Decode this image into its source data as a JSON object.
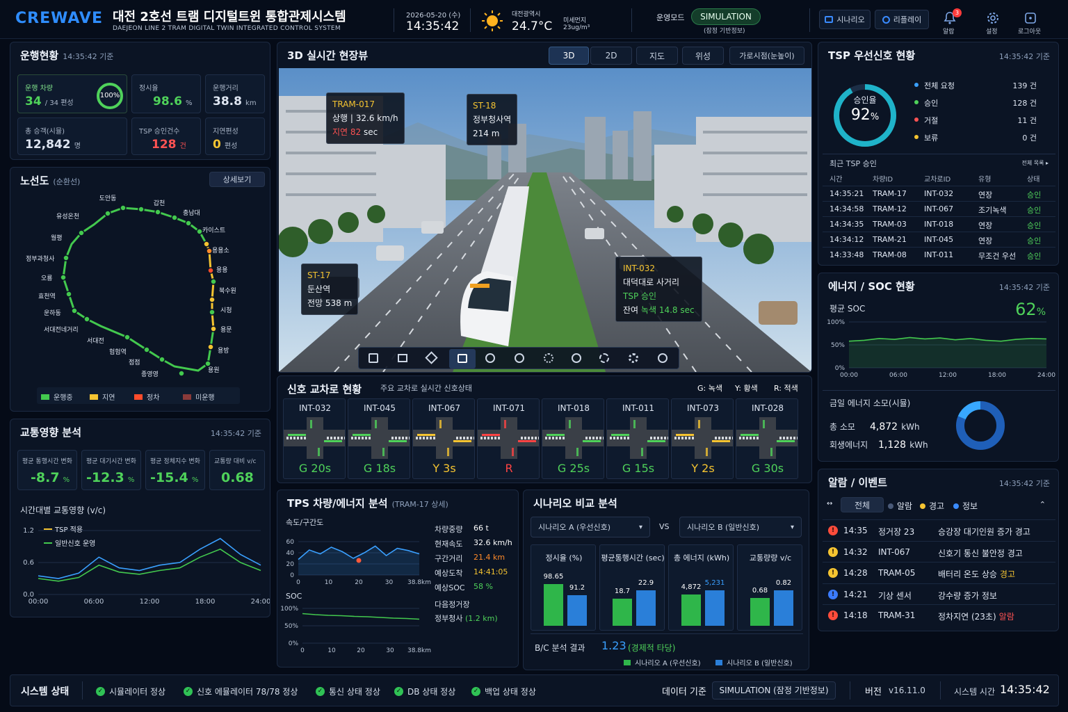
{
  "header": {
    "logo": "CREWAVE",
    "title": "대전 2호선 트램 디지털트윈 통합관제시스템",
    "subtitle": "DAEJEON LINE 2 TRAM DIGITAL TWIN INTEGRATED CONTROL SYSTEM",
    "date": "2026-05-20 (수)",
    "time": "14:35:42",
    "region": "대전광역시",
    "temp": "24.7°C",
    "dust_label": "미세먼지",
    "dust_value": "23ug/m³",
    "mode_label": "운영모드",
    "mode_value": "SIMULATION",
    "mode_sub": "(잠정 기반정보)",
    "btn_scenario": "시나리오",
    "btn_replay": "리플레이",
    "alarm_label": "알람",
    "alarm_count": "3",
    "settings_label": "설정",
    "logout_label": "로그아웃"
  },
  "ops": {
    "title": "운행현황",
    "ts": "14:35:42 기준",
    "c1_label": "운행 차량",
    "c1_value": "34",
    "c1_unit": "/ 34 편성",
    "c1_pct": "100%",
    "c2_label": "정시율",
    "c2_value": "98.6",
    "c2_unit": "%",
    "c3_label": "운행거리",
    "c3_value": "38.8",
    "c3_unit": "km",
    "c4_label": "총 승객(시뮬)",
    "c4_value": "12,842",
    "c4_unit": "명",
    "c5_label": "TSP 승인건수",
    "c5_value": "128",
    "c5_unit": "건",
    "c6_label": "지연편성",
    "c6_value": "0",
    "c6_unit": "편성"
  },
  "route": {
    "title": "노선도",
    "title_sub": "(순환선)",
    "detail_btn": "상세보기",
    "stations": [
      {
        "name": "도안동"
      },
      {
        "name": "갑천"
      },
      {
        "name": "유성온천"
      },
      {
        "name": "충남대"
      },
      {
        "name": "월평"
      },
      {
        "name": "카이스트"
      },
      {
        "name": "정부과청사"
      },
      {
        "name": "용용소"
      },
      {
        "name": "오룡"
      },
      {
        "name": "용용"
      },
      {
        "name": "효천역"
      },
      {
        "name": "북수원"
      },
      {
        "name": "운하동"
      },
      {
        "name": "시청"
      },
      {
        "name": "서대전네거리"
      },
      {
        "name": "용문"
      },
      {
        "name": "서대전"
      },
      {
        "name": "용방"
      },
      {
        "name": "험험역"
      },
      {
        "name": "용원"
      },
      {
        "name": "점점"
      },
      {
        "name": "종영영"
      }
    ],
    "legend": [
      "운행중",
      "지연",
      "정차",
      "미운행"
    ]
  },
  "traffic": {
    "title": "교통영향 분석",
    "ts": "14:35:42 기준",
    "k1_label": "평균 통행시간 변화",
    "k1_value": "-8.7",
    "k1_unit": "%",
    "k2_label": "평균 대기시간 변화",
    "k2_value": "-12.3",
    "k2_unit": "%",
    "k3_label": "평균 정체지수 변화",
    "k3_value": "-15.4",
    "k3_unit": "%",
    "k4_label": "교통량 대비 v/c",
    "k4_value": "0.68",
    "k4_unit": "",
    "chart_title": "시간대별 교통영향 (v/c)",
    "legend_tsp": "TSP 적용",
    "legend_normal": "일반신호 운영"
  },
  "view3d": {
    "title": "3D 실시간 현장뷰",
    "tabs": [
      "3D",
      "2D",
      "지도",
      "위성",
      "가로시점(눈높이)"
    ],
    "tag_tram": {
      "id": "TRAM-017",
      "line2": "상행 | 32.6 km/h",
      "delay_label": "지연",
      "delay_value": "82",
      "delay_unit": "sec"
    },
    "tag_st18": {
      "id": "ST-18",
      "name": "정부청사역",
      "dist": "214 m"
    },
    "tag_st17": {
      "id": "ST-17",
      "name": "둔산역",
      "dist": "전망 538 m"
    },
    "tag_int": {
      "id": "INT-032",
      "name": "대덕대로 사거리",
      "status": "TSP 승인",
      "remain_label": "잔여",
      "remain_green": "녹색 14.8 sec"
    }
  },
  "signal": {
    "title": "신호 교차로 현황",
    "sub": "주요 교차로 실시간 신호상태",
    "leg_g": "G: 녹색",
    "leg_y": "Y: 황색",
    "leg_r": "R: 적색",
    "items": [
      {
        "id": "INT-032",
        "state": "G 20s",
        "color": "#4fd25a"
      },
      {
        "id": "INT-045",
        "state": "G 18s",
        "color": "#4fd25a"
      },
      {
        "id": "INT-067",
        "state": "Y 3s",
        "color": "#f5c431"
      },
      {
        "id": "INT-071",
        "state": "R",
        "color": "#ff4444"
      },
      {
        "id": "INT-018",
        "state": "G 25s",
        "color": "#4fd25a"
      },
      {
        "id": "INT-011",
        "state": "G 15s",
        "color": "#4fd25a"
      },
      {
        "id": "INT-073",
        "state": "Y 2s",
        "color": "#f5c431"
      },
      {
        "id": "INT-028",
        "state": "G 30s",
        "color": "#4fd25a"
      }
    ]
  },
  "tps": {
    "title": "TPS 차량/에너지 분석",
    "sub": "(TRAM-17 상세)",
    "speed_title": "속도/구간도",
    "soc_title": "SOC",
    "rows": [
      {
        "k": "차량중량",
        "v": "66 t"
      },
      {
        "k": "현재속도",
        "v": "32.6 km/h"
      },
      {
        "k": "구간거리",
        "v": "21.4 km"
      },
      {
        "k": "예상도착",
        "v": "14:41:05"
      },
      {
        "k": "예상SOC",
        "v": "58 %"
      }
    ],
    "next_label": "다음정거장",
    "next_value": "정부청사",
    "next_dist": "(1.2 km)"
  },
  "scenario": {
    "title": "시나리오 비교 분석",
    "sel_a": "시나리오 A (우선신호)",
    "sel_b": "시나리오 B (일반신호)",
    "vs": "VS",
    "metrics": [
      {
        "title": "정시율 (%)",
        "a": "98.65",
        "b": "91.2"
      },
      {
        "title": "평균통행시간 (sec)",
        "a": "18.7",
        "b": "22.9"
      },
      {
        "title": "총 에너지 (kWh)",
        "a": "4,872",
        "b": "5,231"
      },
      {
        "title": "교통량량 v/c",
        "a": "0.68",
        "b": "0.82"
      }
    ],
    "bc_label": "B/C 분석 결과",
    "bc_value": "1.23",
    "bc_note": "(경제적 타당)",
    "leg_a": "시나리오 A (우선신호)",
    "leg_b": "시나리오 B (일반신호)"
  },
  "tsp": {
    "title": "TSP 우선신호 현황",
    "ts": "14:35:42 기준",
    "ratio_label": "승인율",
    "ratio_value": "92",
    "ratio_unit": "%",
    "stats": [
      {
        "k": "전체 요청",
        "v": "139 건",
        "c": "#3aa0ff"
      },
      {
        "k": "승인",
        "v": "128 건",
        "c": "#4fd25a"
      },
      {
        "k": "거절",
        "v": "11 건",
        "c": "#ff5353"
      },
      {
        "k": "보류",
        "v": "0 건",
        "c": "#f5c431"
      }
    ],
    "recent_title": "최근 TSP 승인",
    "all_link": "전체 목록 ▸",
    "cols": [
      "시간",
      "차량ID",
      "교차로ID",
      "유형",
      "상태"
    ],
    "rows": [
      [
        "14:35:21",
        "TRAM-17",
        "INT-032",
        "연장",
        "승인"
      ],
      [
        "14:34:58",
        "TRAM-12",
        "INT-067",
        "조기녹색",
        "승인"
      ],
      [
        "14:34:35",
        "TRAM-03",
        "INT-018",
        "연장",
        "승인"
      ],
      [
        "14:34:12",
        "TRAM-21",
        "INT-045",
        "연장",
        "승인"
      ],
      [
        "14:33:48",
        "TRAM-08",
        "INT-011",
        "무조건 우선",
        "승인"
      ]
    ]
  },
  "energy": {
    "title": "에너지 / SOC 현황",
    "ts": "14:35:42 기준",
    "avg_label": "평균 SOC",
    "avg_value": "62",
    "avg_unit": "%",
    "today_title": "금일 에너지 소모(시뮬)",
    "total_label": "총 소모",
    "total_value": "4,872",
    "total_unit": "kWh",
    "regen_label": "회생에너지",
    "regen_value": "1,128",
    "regen_unit": "kWh"
  },
  "alarm": {
    "title": "알람 / 이벤트",
    "ts": "14:35:42 기준",
    "tabs": [
      "전체",
      "알람",
      "경고",
      "정보"
    ],
    "rows": [
      {
        "t": "14:35",
        "src": "정거장 23",
        "msg": "승강장 대기인원 증가 경고",
        "tag": "",
        "icon": "#ff4c3b"
      },
      {
        "t": "14:32",
        "src": "INT-067",
        "msg": "신호기 통신 불안정 경고",
        "tag": "",
        "icon": "#f5c431"
      },
      {
        "t": "14:28",
        "src": "TRAM-05",
        "msg": "배터리 온도 상승",
        "tag": "경고",
        "icon": "#f5c431"
      },
      {
        "t": "14:21",
        "src": "기상 센서",
        "msg": "강수량 증가 정보",
        "tag": "",
        "icon": "#3a7bff"
      },
      {
        "t": "14:18",
        "src": "TRAM-31",
        "msg": "정차지연 (23초)",
        "tag": "알람",
        "icon": "#ff4c3b"
      }
    ]
  },
  "status": {
    "title": "시스템 상태",
    "items": [
      "시뮬레이터 정상",
      "신호 에뮬레이터 78/78 정상",
      "통신 상태 정상",
      "DB 상태 정상",
      "백업 상태 정상"
    ],
    "data_label": "데이터 기준",
    "data_value": "SIMULATION (잠정 기반정보)",
    "ver_label": "버전",
    "ver_value": "v16.11.0",
    "systime_label": "시스템 시간",
    "systime_value": "14:35:42"
  },
  "chart_data": [
    {
      "type": "line",
      "title": "시간대별 교통영향 (v/c)",
      "x": [
        "00:00",
        "06:00",
        "12:00",
        "18:00",
        "24:00"
      ],
      "ylim": [
        0,
        1.2
      ],
      "yticks": [
        "0.0",
        "0.6",
        "1.2"
      ],
      "series": [
        {
          "name": "TSP 적용",
          "color": "#3aa0ff",
          "values": [
            0.35,
            0.3,
            0.4,
            0.7,
            0.5,
            0.45,
            0.55,
            0.6,
            0.85,
            1.05,
            0.75,
            0.55
          ]
        },
        {
          "name": "일반신호 운영",
          "color": "#43c94e",
          "values": [
            0.3,
            0.25,
            0.32,
            0.55,
            0.42,
            0.38,
            0.45,
            0.5,
            0.7,
            0.85,
            0.6,
            0.45
          ]
        }
      ]
    },
    {
      "type": "line",
      "title": "평균 SOC",
      "x": [
        "00:00",
        "06:00",
        "12:00",
        "18:00",
        "24:00"
      ],
      "ylim": [
        0,
        100
      ],
      "yticks": [
        "0%",
        "50%",
        "100%"
      ],
      "series": [
        {
          "name": "SOC",
          "color": "#43c94e",
          "values": [
            58,
            60,
            64,
            62,
            66,
            63,
            65,
            61,
            64,
            60,
            58,
            62,
            64,
            63
          ]
        }
      ]
    },
    {
      "type": "line",
      "title": "속도/구간도",
      "x": [
        "0",
        "10",
        "20",
        "30",
        "38.8km"
      ],
      "ylim": [
        0,
        60
      ],
      "yticks": [
        "0",
        "20",
        "40",
        "60"
      ],
      "series": [
        {
          "name": "speed",
          "color": "#3aa0ff",
          "values": [
            28,
            45,
            38,
            50,
            42,
            30,
            40,
            52,
            35,
            48,
            44,
            38
          ]
        }
      ]
    },
    {
      "type": "line",
      "title": "SOC",
      "x": [
        "0",
        "10",
        "20",
        "30",
        "38.8km"
      ],
      "ylim": [
        0,
        100
      ],
      "yticks": [
        "0%",
        "50%",
        "100%"
      ],
      "series": [
        {
          "name": "soc",
          "color": "#43c94e",
          "values": [
            85,
            82,
            80,
            79,
            77,
            76,
            74,
            72,
            71,
            69
          ]
        }
      ]
    },
    {
      "type": "bar",
      "title": "시나리오 비교 분석",
      "categories": [
        "정시율 (%)",
        "평균통행시간 (sec)",
        "총 에너지 (kWh)",
        "교통량량 v/c"
      ],
      "series": [
        {
          "name": "시나리오 A (우선신호)",
          "values": [
            98.65,
            18.7,
            4872,
            0.68
          ]
        },
        {
          "name": "시나리오 B (일반신호)",
          "values": [
            91.2,
            22.9,
            5231,
            0.82
          ]
        }
      ]
    },
    {
      "type": "pie",
      "title": "금일 에너지 소모(시뮬)",
      "categories": [
        "총 소모",
        "회생에너지"
      ],
      "values": [
        4872,
        1128
      ]
    }
  ]
}
